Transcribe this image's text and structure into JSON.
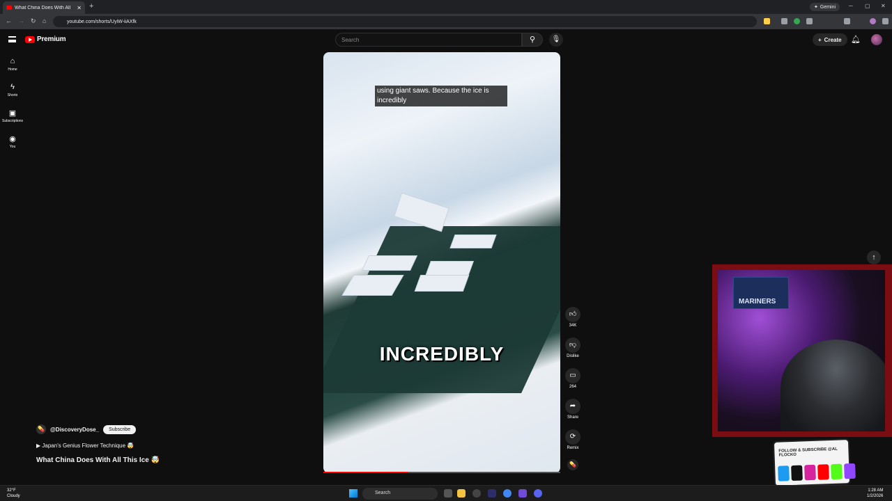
{
  "browser": {
    "tab_title": "What China Does With All",
    "url": "youtube.com/shorts/UyiW-iiAXfk",
    "gemini_label": "Gemini"
  },
  "youtube": {
    "logo_text": "Premium",
    "search_placeholder": "Search",
    "create_label": "Create",
    "sidebar": [
      {
        "label": "Home",
        "icon": "home-icon"
      },
      {
        "label": "Shorts",
        "icon": "shorts-icon"
      },
      {
        "label": "Subscriptions",
        "icon": "subscriptions-icon"
      },
      {
        "label": "You",
        "icon": "you-icon"
      }
    ]
  },
  "short": {
    "caption": "using giant saws. Because the ice is incredibly",
    "overlay_text": "INCREDIBLY",
    "progress": 0.36,
    "actions": {
      "likes": "34K",
      "dislike": "Dislike",
      "comments": "264",
      "share": "Share",
      "remix": "Remix"
    },
    "channel": "@DiscoveryDose_",
    "subscribe": "Subscribe",
    "related": "Japan's Genius Flower Technique 🤯",
    "title": "What China Does With All This Ice 🤯"
  },
  "overlay": {
    "banner_text": "MARINERS",
    "sticker_text": "FOLLOW & SUBSCRIBE @AL FLOCKO"
  },
  "taskbar": {
    "weather_temp": "32°F",
    "weather_desc": "Cloudy",
    "search": "Search",
    "time": "1:28 AM",
    "date": "1/2/2026"
  },
  "colors": {
    "brand_red": "#ff0000",
    "background": "#0f0f0f",
    "webcam_frame": "#7a0d12"
  }
}
